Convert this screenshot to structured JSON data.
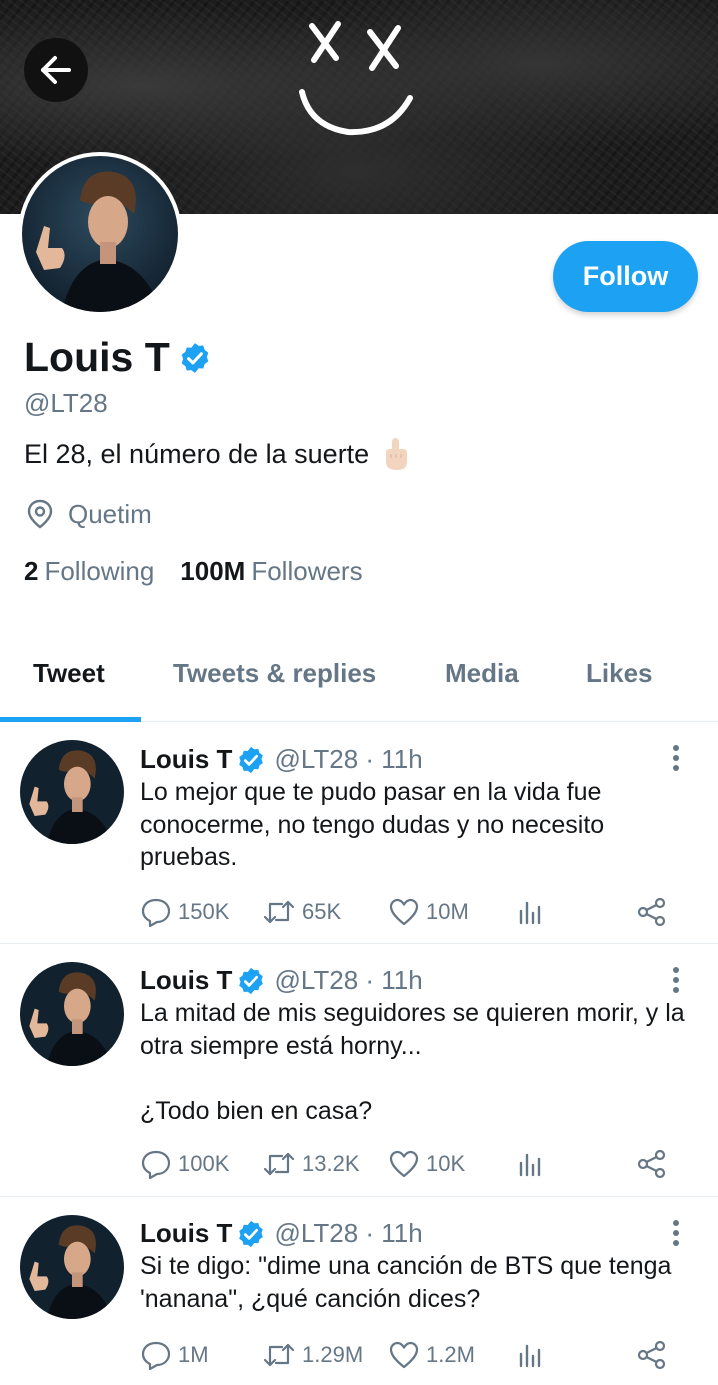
{
  "profile": {
    "name": "Louis T",
    "handle": "@LT28",
    "bio": "El 28, el número de la suerte",
    "location": "Quetim",
    "following_count": "2",
    "following_label": "Following",
    "followers_count": "100M",
    "followers_label": "Followers",
    "follow_label": "Follow"
  },
  "tabs": [
    {
      "label": "Tweet",
      "active": true
    },
    {
      "label": "Tweets & replies",
      "active": false
    },
    {
      "label": "Media",
      "active": false
    },
    {
      "label": "Likes",
      "active": false
    }
  ],
  "tweets": [
    {
      "name": "Louis T",
      "meta": "@LT28 · 11h",
      "text": "Lo mejor que te pudo pasar en la vida fue conocerme, no tengo dudas y no necesito pruebas.",
      "replies": "150K",
      "retweets": "65K",
      "likes": "10M"
    },
    {
      "name": "Louis T",
      "meta": "@LT28 · 11h",
      "text": "La mitad de mis seguidores se quieren morir, y la otra siempre está horny...\n\n¿Todo bien en casa?",
      "replies": "100K",
      "retweets": "13.2K",
      "likes": "10K"
    },
    {
      "name": "Louis T",
      "meta": "@LT28 · 11h",
      "text": "Si te digo: \"dime una canción de BTS que tenga 'nanana\", ¿qué canción dices?",
      "replies": "1M",
      "retweets": "1.29M",
      "likes": "1.2M"
    }
  ],
  "colors": {
    "accent": "#1da1f2",
    "secondary_text": "#657786",
    "primary_text": "#14171a"
  },
  "icons": {
    "back": "arrow-left-icon",
    "verified": "verified-badge-icon",
    "location": "location-pin-icon",
    "reply": "reply-icon",
    "retweet": "retweet-icon",
    "like": "heart-icon",
    "analytics": "analytics-icon",
    "share": "share-icon",
    "more": "more-vertical-icon"
  }
}
